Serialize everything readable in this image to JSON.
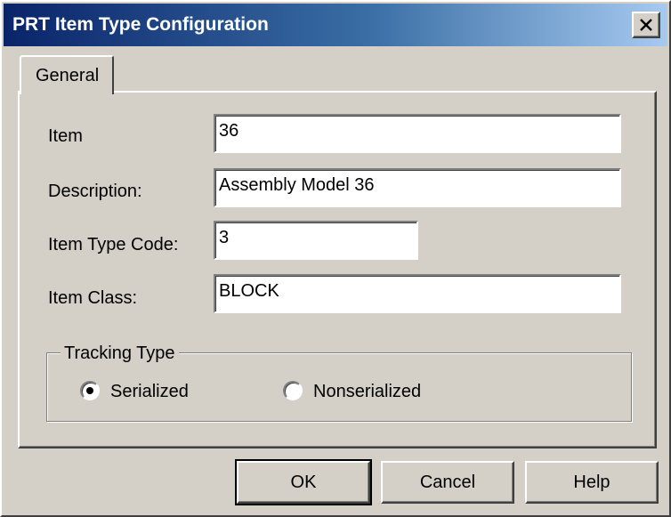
{
  "window": {
    "title": "PRT Item Type Configuration"
  },
  "tabs": [
    {
      "label": "General"
    }
  ],
  "form": {
    "item": {
      "label": "Item",
      "value": "36"
    },
    "description": {
      "label": "Description:",
      "value": "Assembly Model 36"
    },
    "item_type_code": {
      "label": "Item Type Code:",
      "value": "3"
    },
    "item_class": {
      "label": "Item Class:",
      "value": "BLOCK"
    }
  },
  "tracking": {
    "title": "Tracking Type",
    "options": [
      {
        "label": "Serialized",
        "selected": true
      },
      {
        "label": "Nonserialized",
        "selected": false
      }
    ]
  },
  "buttons": {
    "ok": "OK",
    "cancel": "Cancel",
    "help": "Help"
  },
  "icons": {
    "close": "close-icon",
    "radio_selected": "radio-selected-icon",
    "radio_unselected": "radio-unselected-icon"
  }
}
